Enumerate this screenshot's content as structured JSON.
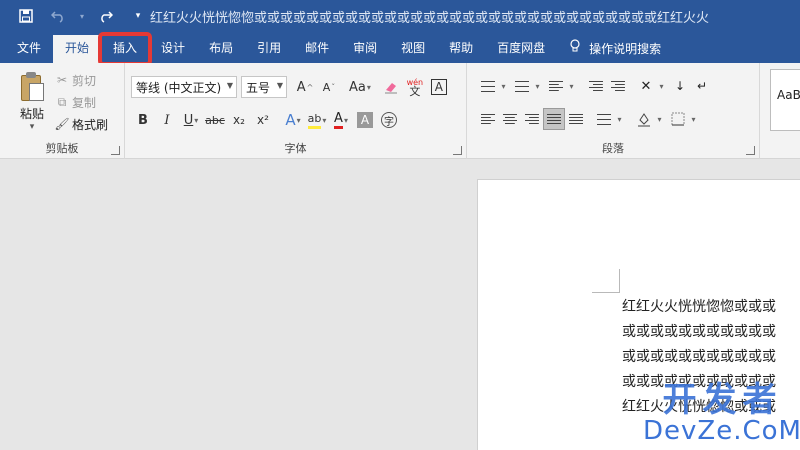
{
  "window": {
    "title": "红红火火恍恍惚惚或或或或或或或或或或或或或或或或或或或或或或或或或或或或或或或红红火火"
  },
  "qat": {
    "save_icon": "save-icon",
    "undo_icon": "undo-icon",
    "redo_icon": "redo-icon",
    "customize_icon": "chevron-down-icon"
  },
  "tabs": [
    {
      "label": "文件"
    },
    {
      "label": "开始"
    },
    {
      "label": "插入"
    },
    {
      "label": "设计"
    },
    {
      "label": "布局"
    },
    {
      "label": "引用"
    },
    {
      "label": "邮件"
    },
    {
      "label": "审阅"
    },
    {
      "label": "视图"
    },
    {
      "label": "帮助"
    },
    {
      "label": "百度网盘"
    },
    {
      "label": "操作说明搜索"
    }
  ],
  "clipboard": {
    "paste": "粘贴",
    "cut": "剪切",
    "copy": "复制",
    "format_painter": "格式刷",
    "group_label": "剪贴板"
  },
  "font": {
    "font_name": "等线 (中文正文)",
    "font_size": "五号",
    "bold": "B",
    "italic": "I",
    "underline": "U",
    "strikethrough": "abc",
    "subscript": "x₂",
    "superscript": "x²",
    "grow": "A",
    "shrink": "A",
    "change_case": "Aa",
    "phonetic": "wén",
    "phonetic_char": "文",
    "border_char": "A",
    "text_effect": "A",
    "highlight": "ab",
    "font_color": "A",
    "shading": "A",
    "enclose": "字",
    "group_label": "字体"
  },
  "paragraph": {
    "group_label": "段落"
  },
  "styles": {
    "sample": "AaBl"
  },
  "document": {
    "lines": [
      "红红火火恍恍惚惚或或或",
      "或或或或或或或或或或或",
      "或或或或或或或或或或或",
      "或或或或或或或或或或或",
      "红红火火恍恍惚惚或或或"
    ]
  },
  "watermark": {
    "cn": "开发者",
    "en": "DevZe.CoM"
  },
  "colors": {
    "ribbon_blue": "#2b579a",
    "highlight_red": "#e53935",
    "font_color_red": "#e02020",
    "highlight_yellow": "#ffeb3b"
  }
}
